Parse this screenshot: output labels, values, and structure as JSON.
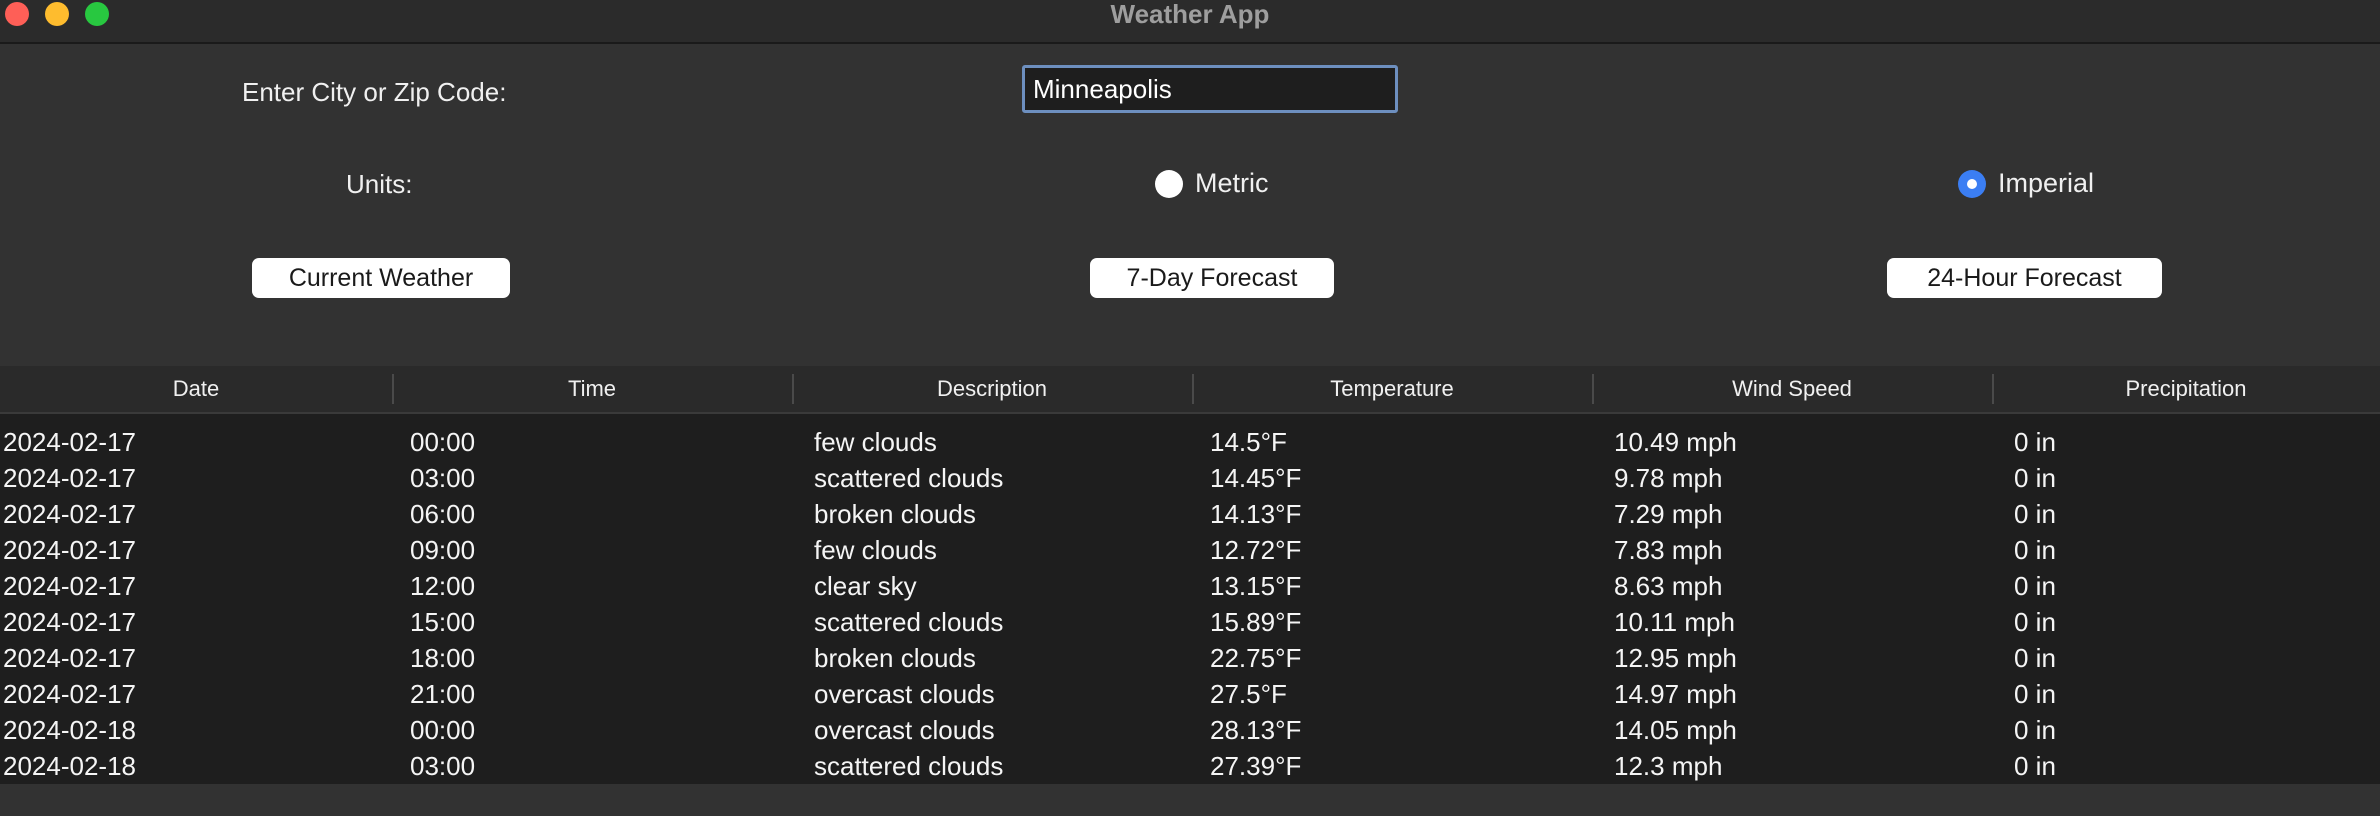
{
  "window": {
    "title": "Weather App"
  },
  "form": {
    "city_label": "Enter City or Zip Code:",
    "city_value": "Minneapolis",
    "units_label": "Units:",
    "units_options": [
      "Metric",
      "Imperial"
    ],
    "units_selected": "Imperial"
  },
  "buttons": {
    "current": "Current Weather",
    "seven_day": "7-Day Forecast",
    "hourly": "24-Hour Forecast"
  },
  "table": {
    "columns": [
      "Date",
      "Time",
      "Description",
      "Temperature",
      "Wind Speed",
      "Precipitation"
    ],
    "rows": [
      [
        "2024-02-17",
        "00:00",
        "few clouds",
        "14.5°F",
        "10.49 mph",
        "0 in"
      ],
      [
        "2024-02-17",
        "03:00",
        "scattered clouds",
        "14.45°F",
        "9.78 mph",
        "0 in"
      ],
      [
        "2024-02-17",
        "06:00",
        "broken clouds",
        "14.13°F",
        "7.29 mph",
        "0 in"
      ],
      [
        "2024-02-17",
        "09:00",
        "few clouds",
        "12.72°F",
        "7.83 mph",
        "0 in"
      ],
      [
        "2024-02-17",
        "12:00",
        "clear sky",
        "13.15°F",
        "8.63 mph",
        "0 in"
      ],
      [
        "2024-02-17",
        "15:00",
        "scattered clouds",
        "15.89°F",
        "10.11 mph",
        "0 in"
      ],
      [
        "2024-02-17",
        "18:00",
        "broken clouds",
        "22.75°F",
        "12.95 mph",
        "0 in"
      ],
      [
        "2024-02-17",
        "21:00",
        "overcast clouds",
        "27.5°F",
        "14.97 mph",
        "0 in"
      ],
      [
        "2024-02-18",
        "00:00",
        "overcast clouds",
        "28.13°F",
        "14.05 mph",
        "0 in"
      ],
      [
        "2024-02-18",
        "03:00",
        "scattered clouds",
        "27.39°F",
        "12.3 mph",
        "0 in"
      ]
    ]
  },
  "colors": {
    "background": "#323232",
    "table_background": "#1e1e1e",
    "accent": "#3b7ef3",
    "input_border": "#6d8fbf"
  }
}
